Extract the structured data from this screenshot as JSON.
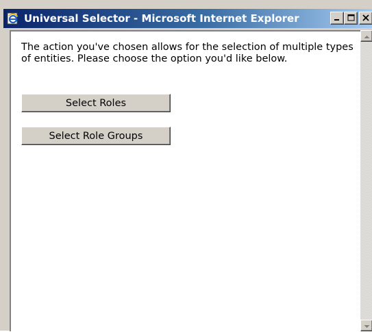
{
  "window": {
    "title": "Universal Selector - Microsoft Internet Explorer",
    "icon": "internet-explorer-icon",
    "controls": {
      "minimize": "minimize-icon",
      "maximize": "maximize-icon",
      "close": "close-icon"
    }
  },
  "content": {
    "message": "The action you've chosen allows for the selection of multiple types of entities. Please choose the option you'd like below.",
    "buttons": {
      "select_roles": "Select Roles",
      "select_role_groups": "Select Role Groups"
    }
  },
  "scrollbar": {
    "up": "scroll-up-arrow-icon",
    "down": "scroll-down-arrow-icon"
  },
  "colors": {
    "title_bar_start": "#0a246a",
    "title_bar_end": "#a6caf0",
    "button_face": "#d4d0c8",
    "page_background": "#ffffff"
  }
}
